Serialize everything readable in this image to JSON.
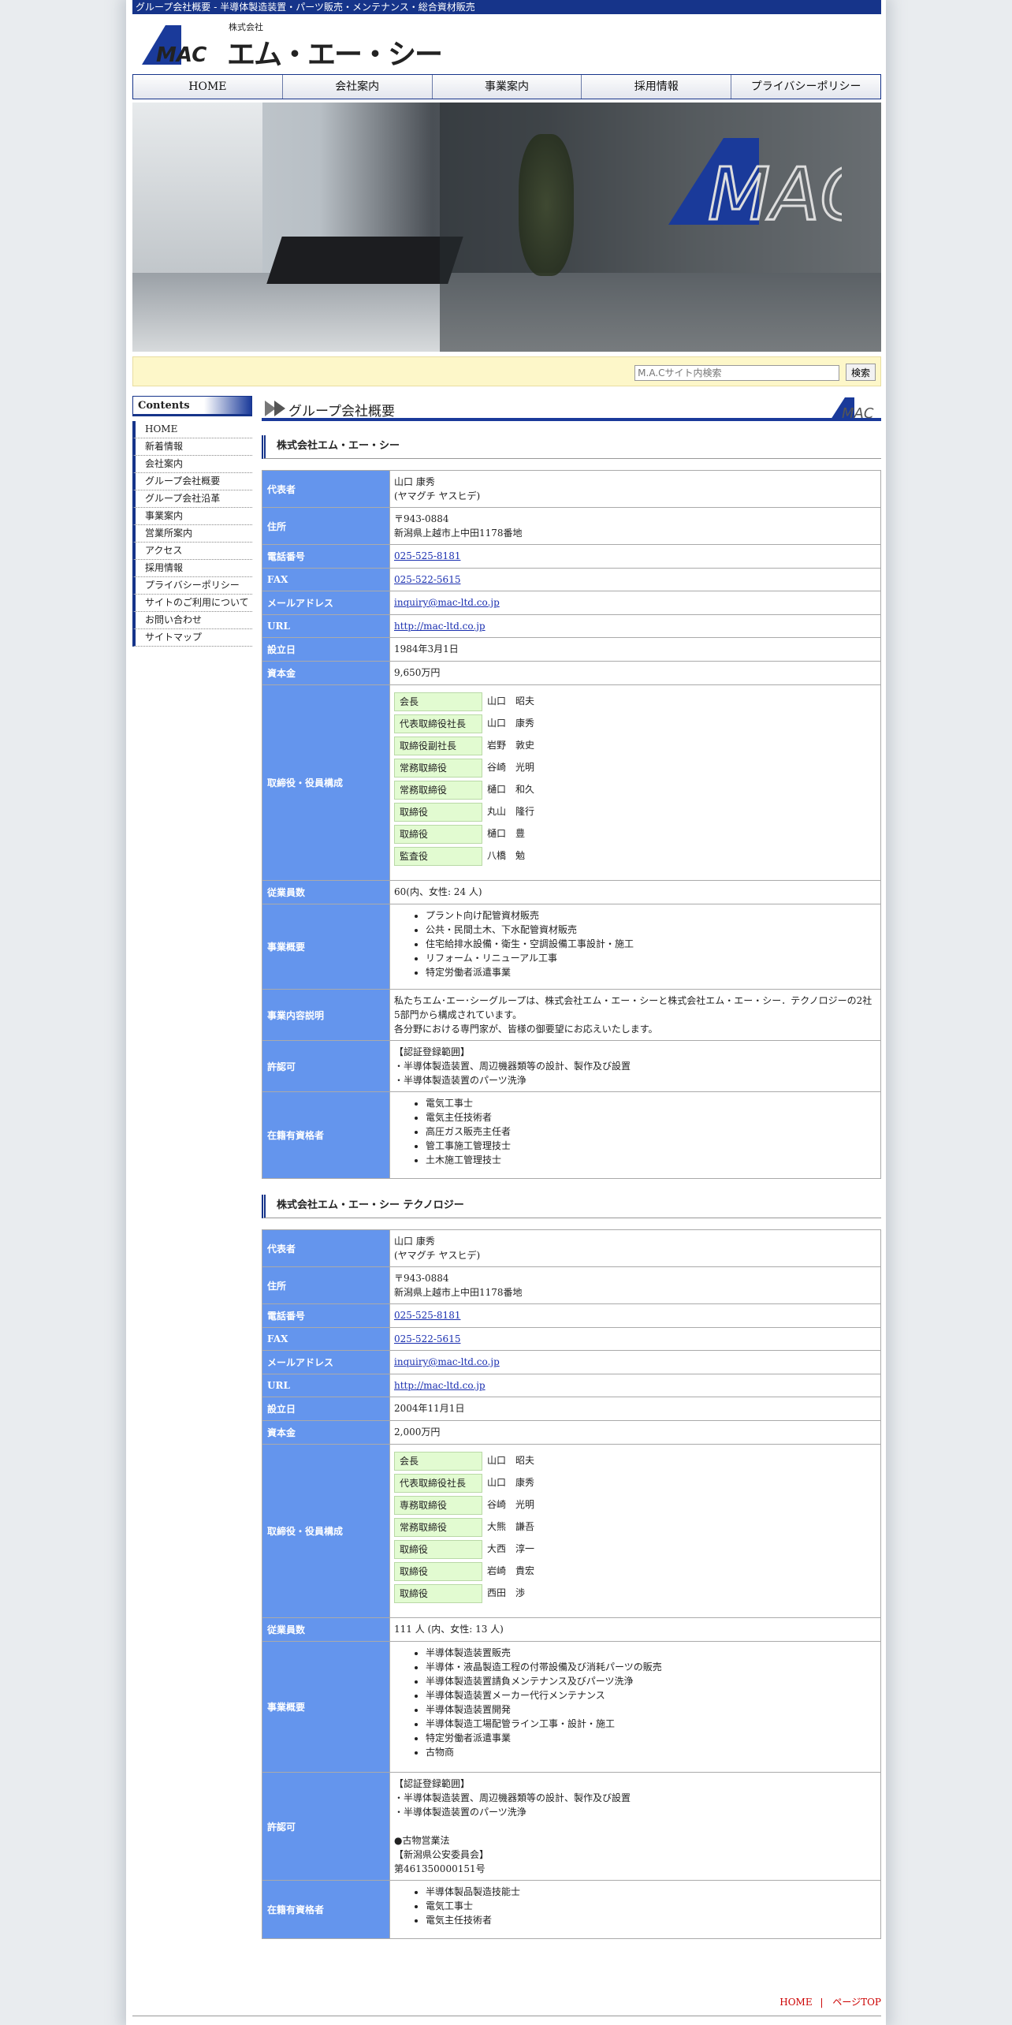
{
  "topbar": {
    "text": "グループ会社概要 - 半導体製造装置・パーツ販売・メンテナンス・総合資材販売"
  },
  "logo": {
    "small": "株式会社",
    "name": "エム・エー・シー",
    "mark": "MAC"
  },
  "nav": [
    "HOME",
    "会社案内",
    "事業案内",
    "採用情報",
    "プライバシーポリシー"
  ],
  "search": {
    "placeholder": "M.A.Cサイト内検索",
    "button": "検索"
  },
  "sidebar": {
    "title": "Contents",
    "items": [
      "HOME",
      "新着情報",
      "会社案内",
      "グループ会社概要",
      "グループ会社沿革",
      "事業案内",
      "営業所案内",
      "アクセス",
      "採用情報",
      "プライバシーポリシー",
      "サイトのご利用について",
      "お問い合わせ",
      "サイトマップ"
    ]
  },
  "page_title": "グループ会社概要",
  "companies": [
    {
      "name": "株式会社エム・エー・シー",
      "rep_label": "代表者",
      "rep": "山口 康秀",
      "rep_kana": "(ヤマグチ ヤスヒデ)",
      "addr_label": "住所",
      "zip": "〒943-0884",
      "addr": "新潟県上越市上中田1178番地",
      "tel_label": "電話番号",
      "tel": "025-525-8181",
      "fax_label": "FAX",
      "fax": "025-522-5615",
      "mail_label": "メールアドレス",
      "mail": "inquiry@mac-ltd.co.jp",
      "url_label": "URL",
      "url": "http://mac-ltd.co.jp",
      "est_label": "設立日",
      "est": "1984年3月1日",
      "cap_label": "資本金",
      "cap": "9,650万円",
      "board_label": "取締役・役員構成",
      "board": [
        {
          "role": "会長",
          "name": "山口　昭夫"
        },
        {
          "role": "代表取締役社長",
          "name": "山口　康秀"
        },
        {
          "role": "取締役副社長",
          "name": "岩野　敦史"
        },
        {
          "role": "常務取締役",
          "name": "谷崎　光明"
        },
        {
          "role": "常務取締役",
          "name": "樋口　和久"
        },
        {
          "role": "取締役",
          "name": "丸山　隆行"
        },
        {
          "role": "取締役",
          "name": "樋口　豊"
        },
        {
          "role": "監査役",
          "name": "八橋　勉"
        }
      ],
      "emp_label": "従業員数",
      "emp": "60(内、女性: 24 人)",
      "biz_label": "事業概要",
      "biz": [
        "プラント向け配管資材販売",
        "公共・民間土木、下水配管資材販売",
        "住宅給排水設備・衛生・空調設備工事設計・施工",
        "リフォーム・リニューアル工事",
        "特定労働者派遣事業"
      ],
      "desc_label": "事業内容説明",
      "desc": [
        "私たちエム･エー･シーグループは、株式会社エム・エー・シーと株式会社エム・エー・シー．テクノロジーの2社5部門から構成されています。",
        "各分野における専門家が、皆様の御要望にお応えいたします。"
      ],
      "lic_label": "許認可",
      "lic": [
        "【認証登録範囲】",
        "・半導体製造装置、周辺機器類等の設計、製作及び設置",
        "・半導体製造装置のパーツ洗浄"
      ],
      "qual_label": "在籍有資格者",
      "qual": [
        "電気工事士",
        "電気主任技術者",
        "高圧ガス販売主任者",
        "管工事施工管理技士",
        "土木施工管理技士"
      ]
    },
    {
      "name": "株式会社エム・エー・シー テクノロジー",
      "rep_label": "代表者",
      "rep": "山口 康秀",
      "rep_kana": "(ヤマグチ ヤスヒデ)",
      "addr_label": "住所",
      "zip": "〒943-0884",
      "addr": "新潟県上越市上中田1178番地",
      "tel_label": "電話番号",
      "tel": "025-525-8181",
      "fax_label": "FAX",
      "fax": "025-522-5615",
      "mail_label": "メールアドレス",
      "mail": "inquiry@mac-ltd.co.jp",
      "url_label": "URL",
      "url": "http://mac-ltd.co.jp",
      "est_label": "設立日",
      "est": "2004年11月1日",
      "cap_label": "資本金",
      "cap": "2,000万円",
      "board_label": "取締役・役員構成",
      "board": [
        {
          "role": "会長",
          "name": "山口　昭夫"
        },
        {
          "role": "代表取締役社長",
          "name": "山口　康秀"
        },
        {
          "role": "専務取締役",
          "name": "谷崎　光明"
        },
        {
          "role": "常務取締役",
          "name": "大熊　謙吾"
        },
        {
          "role": "取締役",
          "name": "大西　淳一"
        },
        {
          "role": "取締役",
          "name": "岩崎　貴宏"
        },
        {
          "role": "取締役",
          "name": "西田　渉"
        }
      ],
      "emp_label": "従業員数",
      "emp": "111 人 (内、女性: 13 人)",
      "biz_label": "事業概要",
      "biz": [
        "半導体製造装置販売",
        "半導体・液晶製造工程の付帯設備及び消耗パーツの販売",
        "半導体製造装置請負メンテナンス及びパーツ洗浄",
        "半導体製造装置メーカー代行メンテナンス",
        "半導体製造装置開発",
        "半導体製造工場配管ライン工事・設計・施工",
        "特定労働者派遣事業",
        "古物商"
      ],
      "lic_label": "許認可",
      "lic": [
        "【認証登録範囲】",
        "・半導体製造装置、周辺機器類等の設計、製作及び設置",
        "・半導体製造装置のパーツ洗浄",
        "",
        "●古物営業法",
        "【新潟県公安委員会】",
        "第461350000151号"
      ],
      "qual_label": "在籍有資格者",
      "qual": [
        "半導体製品製造技能士",
        "電気工事士",
        "電気主任技術者"
      ]
    }
  ],
  "footer": {
    "home": "HOME",
    "sep": "|",
    "top": "ページTOP"
  },
  "colors": {
    "primary": "#16348a",
    "header_cell": "#6495ed",
    "role_cell": "#e2fbd1",
    "search_bg": "#fdf7c9"
  }
}
